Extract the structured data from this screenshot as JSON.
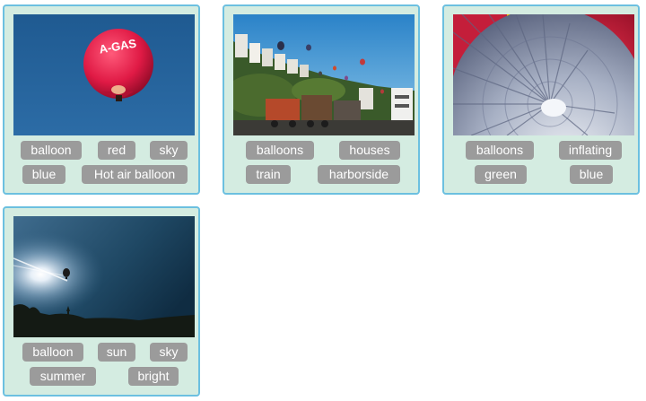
{
  "cards": [
    {
      "image_subject": "red hot air balloon with A-GAS lettering in clear blue sky",
      "balloon_text": "A-GAS",
      "tags": [
        "balloon",
        "red",
        "sky",
        "blue",
        "Hot air balloon"
      ]
    },
    {
      "image_subject": "balloons over houses with old train wagons at harborside",
      "tags": [
        "balloons",
        "houses",
        "train",
        "harborside"
      ]
    },
    {
      "image_subject": "hot air balloons inflating, silver and red envelopes",
      "tags": [
        "balloons",
        "inflating",
        "green",
        "blue"
      ]
    },
    {
      "image_subject": "small balloon silhouette against bright sun in summer sky",
      "tags": [
        "balloon",
        "sun",
        "sky",
        "summer",
        "bright"
      ]
    }
  ],
  "colors": {
    "card_bg": "#d4ece1",
    "card_border": "#6cc0e0",
    "tag_bg": "#9b9b9b",
    "tag_text": "#ffffff"
  }
}
